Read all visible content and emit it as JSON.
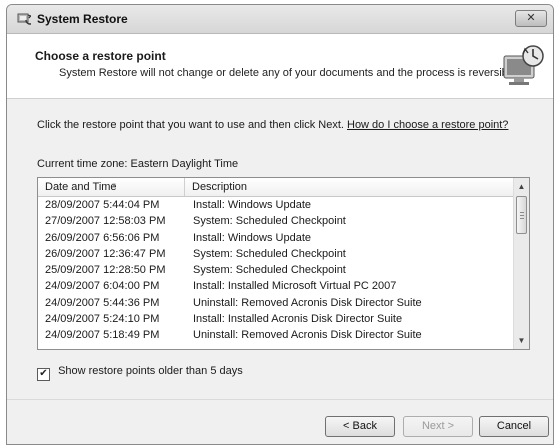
{
  "window": {
    "title": "System Restore"
  },
  "header": {
    "title": "Choose a restore point",
    "subtitle": "System Restore will not change or delete any of your documents and the process is reversible."
  },
  "instruction": {
    "text": "Click the restore point that you want to use and then click Next.",
    "link": "How do I choose a restore point?"
  },
  "timezone": "Current time zone: Eastern Daylight Time",
  "list": {
    "columns": [
      "Date and Time",
      "Description"
    ],
    "rows": [
      {
        "date": "28/09/2007 5:44:04 PM",
        "description": "Install: Windows Update"
      },
      {
        "date": "27/09/2007 12:58:03 PM",
        "description": "System: Scheduled Checkpoint"
      },
      {
        "date": "26/09/2007 6:56:06 PM",
        "description": "Install: Windows Update"
      },
      {
        "date": "26/09/2007 12:36:47 PM",
        "description": "System: Scheduled Checkpoint"
      },
      {
        "date": "25/09/2007 12:28:50 PM",
        "description": "System: Scheduled Checkpoint"
      },
      {
        "date": "24/09/2007 6:04:00 PM",
        "description": "Install: Installed Microsoft Virtual PC 2007"
      },
      {
        "date": "24/09/2007 5:44:36 PM",
        "description": "Uninstall: Removed Acronis Disk Director Suite"
      },
      {
        "date": "24/09/2007 5:24:10 PM",
        "description": "Install: Installed Acronis Disk Director Suite"
      },
      {
        "date": "24/09/2007 5:18:49 PM",
        "description": "Uninstall: Removed Acronis Disk Director Suite"
      }
    ]
  },
  "checkbox": {
    "label": "Show restore points older than 5 days",
    "checked": true
  },
  "buttons": {
    "back": "< Back",
    "next": "Next >",
    "cancel": "Cancel"
  },
  "icons": {
    "app": "system-restore-icon",
    "header": "restore-computer-icon",
    "close": "close-icon",
    "sort": "sort-arrow-icon"
  }
}
